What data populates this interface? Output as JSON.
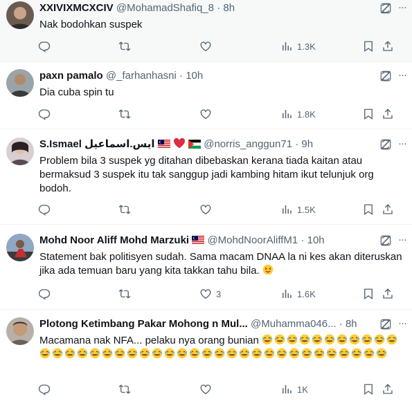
{
  "tweets": [
    {
      "name": "XXIVIXMCXCIV",
      "handle": "@MohamadShafiq_8",
      "dot": "·",
      "time": "8h",
      "text": "Nak bodohkan suspek",
      "stats": {
        "reply": "",
        "retweet": "",
        "like": "",
        "views": "1.3K"
      }
    },
    {
      "name": "paxn pamalo",
      "handle": "@_farhanhasni",
      "dot": "·",
      "time": "10h",
      "text": "Dia cuba spin tu",
      "stats": {
        "reply": "",
        "retweet": "",
        "like": "",
        "views": "1.8K"
      }
    },
    {
      "name": "S.Ismael ايس.اسماعيل",
      "handle": "@norris_anggun71",
      "dot": "·",
      "time": "9h",
      "text": "Problem bila 3 suspek yg ditahan dibebaskan kerana tiada kaitan atau bermaksud 3 suspek itu tak sanggup jadi kambing hitam ikut telunjuk org bodoh.",
      "stats": {
        "reply": "",
        "retweet": "",
        "like": "",
        "views": "1.5K"
      }
    },
    {
      "name": "Mohd Noor Aliff Mohd Marzuki",
      "handle": "@MohdNoorAliffM1",
      "dot": "·",
      "time": "10h",
      "text": "Statement bak politisyen sudah. Sama macam DNAA la ni kes akan diteruskan jika ada temuan baru yang kita takkan tahu bila.",
      "stats": {
        "reply": "",
        "retweet": "",
        "like": "3",
        "views": "1.6K"
      }
    },
    {
      "name": "Plotong Ketimbang Pakar Mohong n Mul...",
      "handle": "@Muhamma046...",
      "dot": "·",
      "time": "8h",
      "text": "Macamana nak NFA... pelaku nya orang bunian",
      "stats": {
        "reply": "",
        "retweet": "",
        "like": "",
        "views": "1K"
      }
    }
  ],
  "icons": {
    "grok": "grok-icon",
    "more": "more-icon",
    "reply": "reply-icon",
    "retweet": "retweet-icon",
    "like": "heart-icon",
    "views": "views-icon",
    "bookmark": "bookmark-icon",
    "share": "share-icon"
  },
  "colors": {
    "text": "#0f1419",
    "muted": "#536471",
    "divider": "#eff3f4"
  }
}
